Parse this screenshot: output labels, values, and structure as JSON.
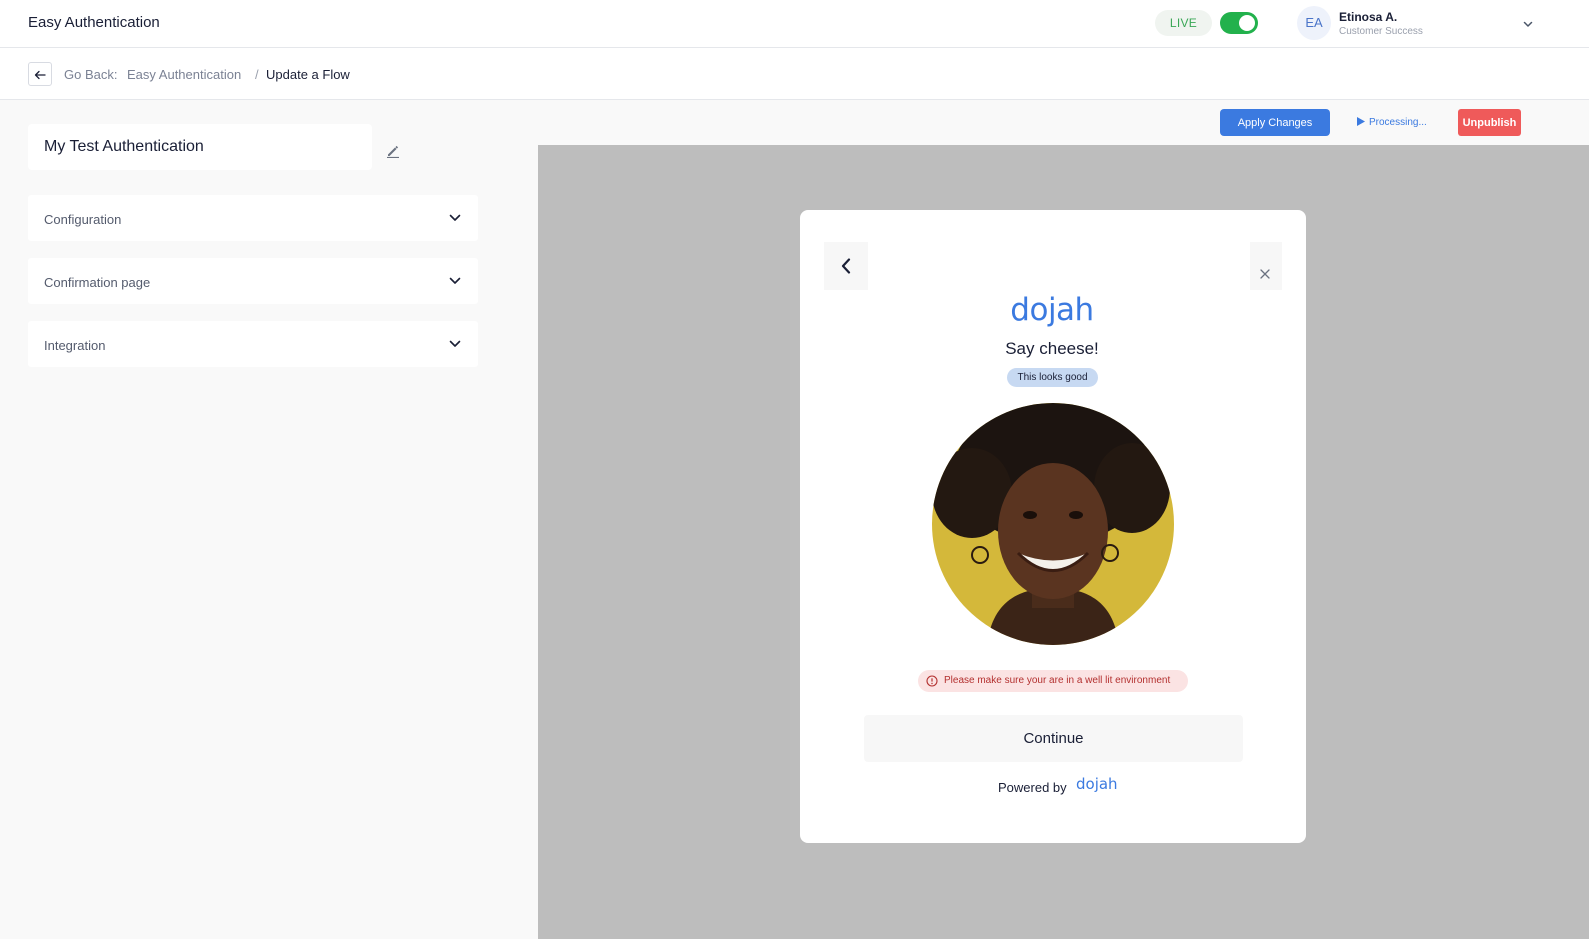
{
  "header": {
    "app_title": "Easy Authentication",
    "live_label": "LIVE",
    "live_enabled": true,
    "user": {
      "initials": "EA",
      "name": "Etinosa A.",
      "role": "Customer Success"
    }
  },
  "breadcrumb": {
    "go_back": "Go Back:",
    "parent": "Easy Authentication",
    "separator": "/",
    "current": "Update a Flow"
  },
  "left_panel": {
    "flow_name": "My Test Authentication",
    "sections": [
      {
        "label": "Configuration"
      },
      {
        "label": "Confirmation page"
      },
      {
        "label": "Integration"
      }
    ]
  },
  "actions": {
    "apply_label": "Apply Changes",
    "processing_label": "Processing...",
    "unpublish_label": "Unpublish"
  },
  "preview": {
    "brand": "dojah",
    "heading": "Say cheese!",
    "status_badge": "This looks good",
    "warning": "Please make sure your are in a well lit environment",
    "continue_label": "Continue",
    "powered_by": "Powered by",
    "powered_brand": "dojah"
  },
  "colors": {
    "accent": "#3b7ae0",
    "live_toggle": "#22b14c",
    "danger": "#ef5a5a",
    "selfie_background": "#d4b83a"
  },
  "icons": [
    "back-arrow-icon",
    "chevron-down-icon",
    "edit-pencil-icon",
    "play-icon",
    "chevron-left-icon",
    "close-icon",
    "info-circle-icon"
  ]
}
